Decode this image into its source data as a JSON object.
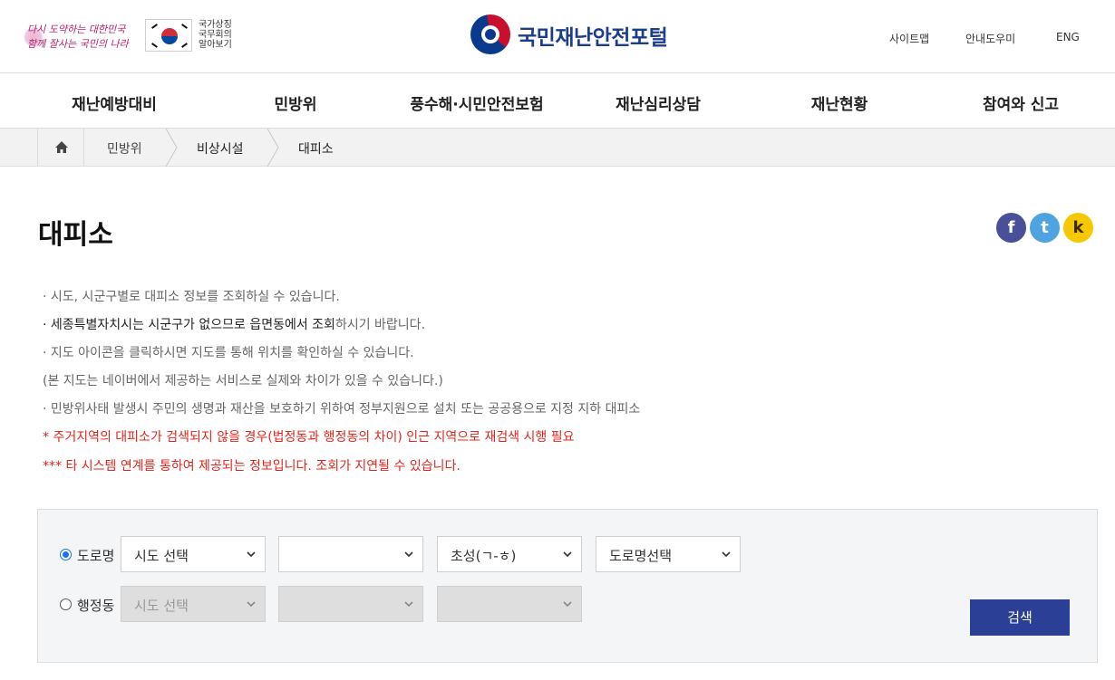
{
  "header": {
    "slogan_line1": "다시 도약하는 대한민국",
    "slogan_line2": "함께 잘사는 국민의 나라",
    "symbol_text": [
      "국가상징",
      "국무회의",
      "알아보기"
    ],
    "logo_text": "국민재난안전포털",
    "util_links": [
      "사이트맵",
      "안내도우미",
      "ENG"
    ]
  },
  "nav": {
    "items": [
      "재난예방대비",
      "민방위",
      "풍수해·시민안전보험",
      "재난심리상담",
      "재난현황",
      "참여와 신고"
    ]
  },
  "breadcrumb": {
    "items": [
      "민방위",
      "비상시설",
      "대피소"
    ]
  },
  "page": {
    "title": "대피소",
    "sns": [
      "f",
      "t",
      "k"
    ]
  },
  "info": {
    "line1": "· 시도, 시군구별로 대피소 정보를 조회하실 수 있습니다.",
    "line2_strong": "· 세종특별자치시는 시군구가 없으므로 읍면동에서 조회",
    "line2_rest": "하시기 바랍니다.",
    "line3": "· 지도 아이콘을 클릭하시면 지도를 통해 위치를 확인하실 수 있습니다.",
    "line4": "(본 지도는 네이버에서 제공하는 서비스로 실제와 차이가 있을 수 있습니다.)",
    "line5": "· 민방위사태 발생시 주민의 생명과 재산을 보호하기 위하여 정부지원으로 설치 또는 공공용으로 지정 지하 대피소",
    "line6": "* 주거지역의 대피소가 검색되지 않을 경우(법정동과 행정동의 차이) 인근 지역으로 재검색 시행 필요",
    "line7": "*** 타 시스템 연계를 통하여 제공되는 정보입니다. 조회가 지연될 수 있습니다."
  },
  "search": {
    "road_label": "도로명",
    "road_selected": true,
    "road_selects": [
      "시도 선택",
      "",
      "초성(ㄱ-ㅎ)",
      "도로명선택"
    ],
    "admin_label": "행정동",
    "admin_selected": false,
    "admin_selects": [
      "시도 선택",
      "",
      ""
    ],
    "button": "검색"
  },
  "colors": {
    "accent": "#2b3f96",
    "warning": "#e1251b",
    "facebook": "#4a4f9a",
    "twitter": "#4fa3e0",
    "kakao": "#f5c800"
  }
}
